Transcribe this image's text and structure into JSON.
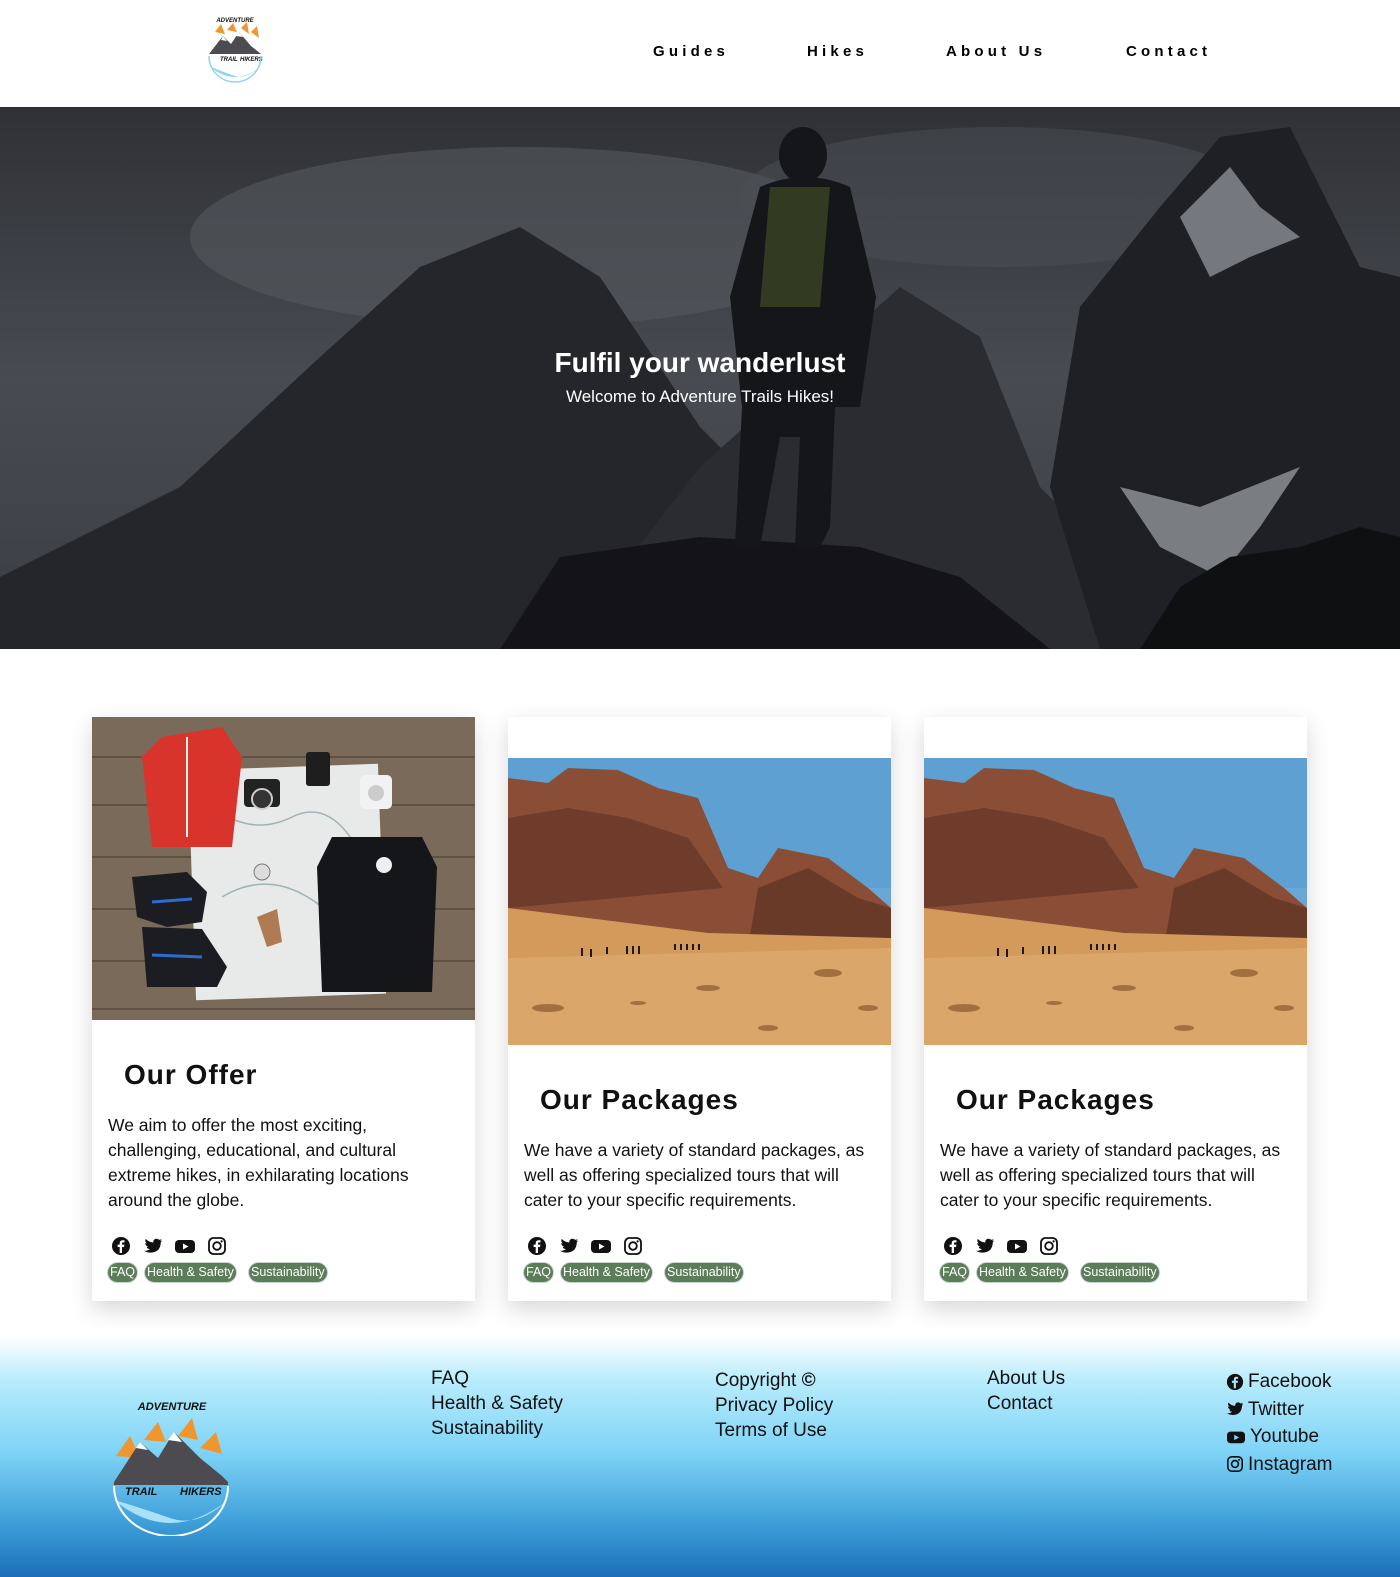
{
  "brand": {
    "logo_text_top": "ADVENTURE",
    "logo_text_left": "TRAIL",
    "logo_text_right": "HIKERS"
  },
  "nav": {
    "items": [
      "Guides",
      "Hikes",
      "About Us",
      "Contact"
    ]
  },
  "hero": {
    "title": "Fulfil your wanderlust",
    "subtitle": "Welcome to Adventure Trails Hikes!"
  },
  "cards": [
    {
      "title": "Our Offer",
      "text": "We aim to offer the most exciting, challenging, educational, and cultural extreme hikes, in exhilarating locations around the globe.",
      "image": "travel-gear-flatlay-image",
      "socials": [
        "facebook-icon",
        "twitter-icon",
        "youtube-icon",
        "instagram-icon"
      ],
      "tags": [
        "FAQ",
        "Health & Safety",
        "Sustainability"
      ]
    },
    {
      "title": "Our Packages",
      "text": "We have a variety of standard packages, as well as offering specialized tours that will cater to your specific requirements.",
      "image": "desert-hikers-image",
      "socials": [
        "facebook-icon",
        "twitter-icon",
        "youtube-icon",
        "instagram-icon"
      ],
      "tags": [
        "FAQ",
        "Health & Safety",
        "Sustainability"
      ]
    },
    {
      "title": "Our Packages",
      "text": "We have a variety of standard packages, as well as offering specialized tours that will cater to your specific requirements.",
      "image": "desert-hikers-image",
      "socials": [
        "facebook-icon",
        "twitter-icon",
        "youtube-icon",
        "instagram-icon"
      ],
      "tags": [
        "FAQ",
        "Health & Safety",
        "Sustainability"
      ]
    }
  ],
  "footer": {
    "col1": [
      "FAQ",
      "Health & Safety",
      "Sustainability"
    ],
    "col2": [
      "Copyright",
      "Privacy Policy",
      "Terms of Use"
    ],
    "copyright_symbol": "©",
    "col3": [
      "About Us",
      "Contact"
    ],
    "social": [
      "Facebook",
      "Twitter",
      "Youtube",
      "Instagram"
    ]
  },
  "colors": {
    "tag_bg": "#5b7d5a",
    "logo_orange": "#f0962f",
    "footer_blue_top": "#b9ecfc",
    "footer_blue_bottom": "#1b6fb8"
  }
}
